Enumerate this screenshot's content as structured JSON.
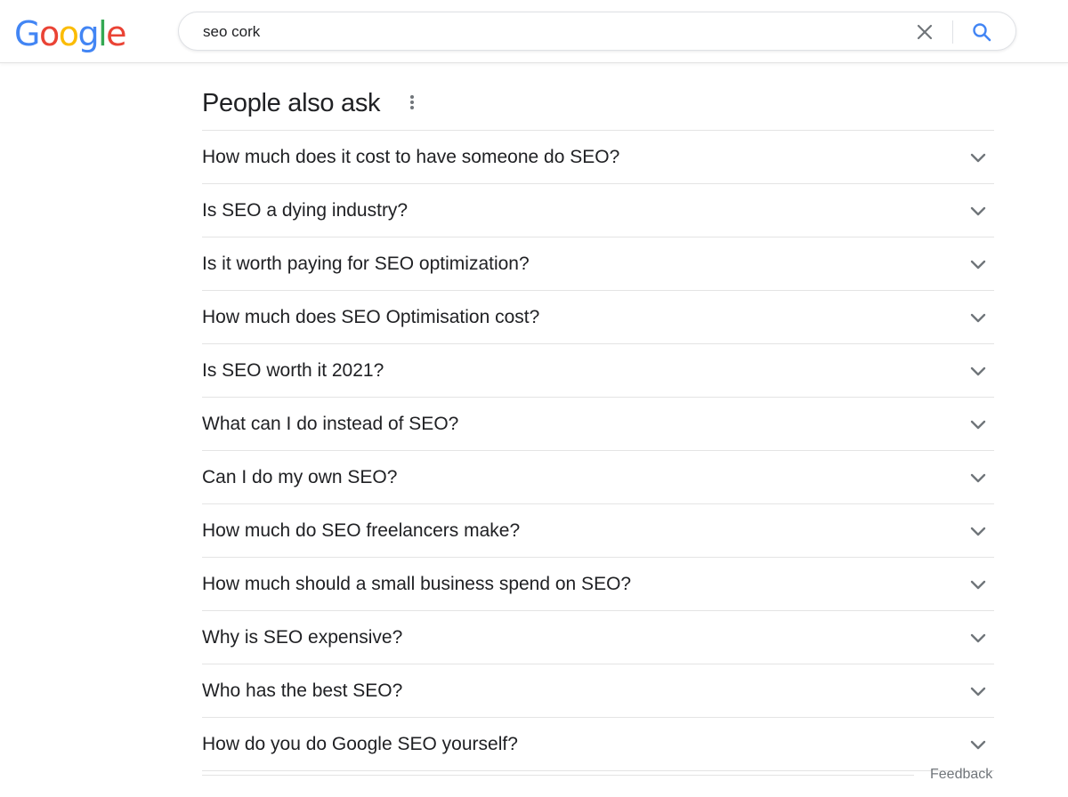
{
  "logo": {
    "letters": [
      {
        "char": "G",
        "color": "#4285F4"
      },
      {
        "char": "o",
        "color": "#EA4335"
      },
      {
        "char": "o",
        "color": "#FBBC05"
      },
      {
        "char": "g",
        "color": "#4285F4"
      },
      {
        "char": "l",
        "color": "#34A853"
      },
      {
        "char": "e",
        "color": "#EA4335"
      }
    ]
  },
  "search": {
    "query": "seo cork",
    "clear_icon": "close-icon",
    "search_icon": "magnifier-icon",
    "search_icon_color": "#4285F4"
  },
  "people_also_ask": {
    "title": "People also ask",
    "menu_icon": "more-vertical-icon",
    "questions": [
      "How much does it cost to have someone do SEO?",
      "Is SEO a dying industry?",
      "Is it worth paying for SEO optimization?",
      "How much does SEO Optimisation cost?",
      "Is SEO worth it 2021?",
      "What can I do instead of SEO?",
      "Can I do my own SEO?",
      "How much do SEO freelancers make?",
      "How much should a small business spend on SEO?",
      "Why is SEO expensive?",
      "Who has the best SEO?",
      "How do you do Google SEO yourself?"
    ],
    "expand_icon": "chevron-down-icon"
  },
  "feedback_label": "Feedback"
}
